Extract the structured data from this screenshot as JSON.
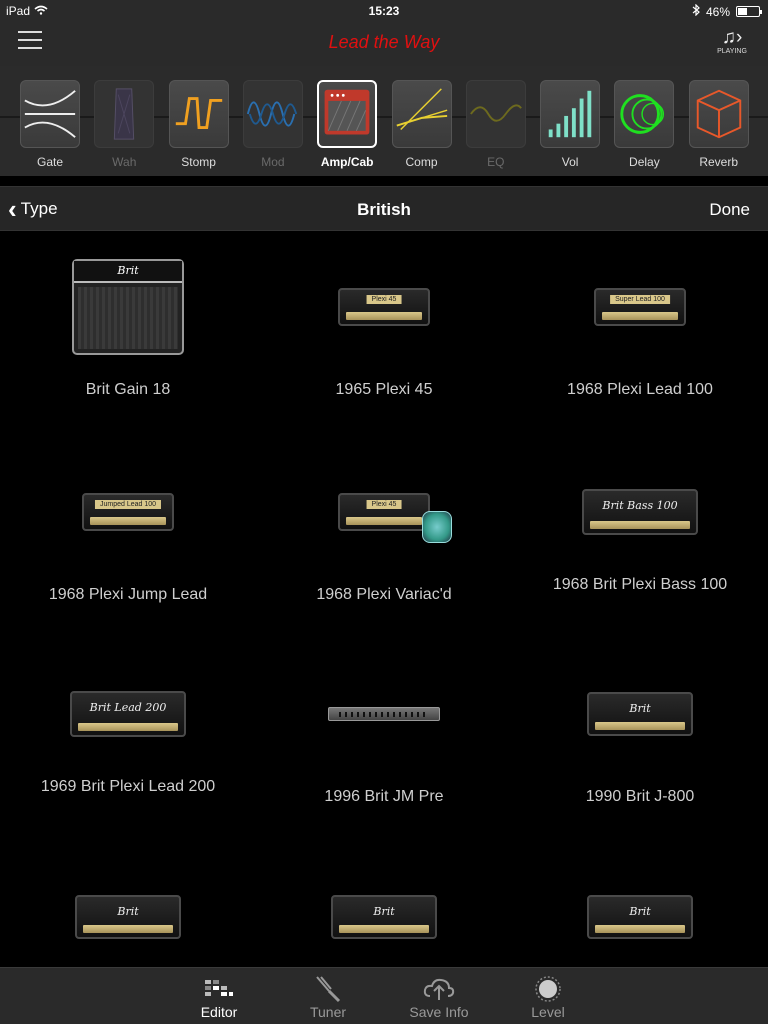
{
  "status_bar": {
    "device": "iPad",
    "time": "15:23",
    "battery": "46%",
    "battery_level": 0.46
  },
  "nav": {
    "preset_title": "Lead the Way",
    "playing_label": "PLAYING"
  },
  "effects_chain": [
    {
      "label": "Gate",
      "icon": "gate-icon",
      "state": "normal"
    },
    {
      "label": "Wah",
      "icon": "wah-icon",
      "state": "dim"
    },
    {
      "label": "Stomp",
      "icon": "stomp-icon",
      "state": "normal"
    },
    {
      "label": "Mod",
      "icon": "mod-icon",
      "state": "dim"
    },
    {
      "label": "Amp/Cab",
      "icon": "amp-icon",
      "state": "active"
    },
    {
      "label": "Comp",
      "icon": "comp-icon",
      "state": "normal"
    },
    {
      "label": "EQ",
      "icon": "eq-icon",
      "state": "dim"
    },
    {
      "label": "Vol",
      "icon": "vol-icon",
      "state": "normal"
    },
    {
      "label": "Delay",
      "icon": "delay-icon",
      "state": "normal"
    },
    {
      "label": "Reverb",
      "icon": "reverb-icon",
      "state": "normal"
    }
  ],
  "subheader": {
    "back_label": "Type",
    "title": "British",
    "done_label": "Done"
  },
  "amps": [
    {
      "label": "Brit Gain 18",
      "style": "combo",
      "logo": "Brit"
    },
    {
      "label": "1965 Plexi 45",
      "style": "plexi",
      "plate": "Plexi 45"
    },
    {
      "label": "1968 Plexi Lead 100",
      "style": "plexi",
      "plate": "Super Lead 100"
    },
    {
      "label": "1968 Plexi Jump Lead",
      "style": "plexi",
      "plate": "Jumped Lead 100"
    },
    {
      "label": "1968 Plexi Variac'd",
      "style": "variac",
      "plate": "Plexi 45"
    },
    {
      "label": "1968 Brit Plexi Bass 100",
      "style": "brit",
      "logo": "Brit Bass 100"
    },
    {
      "label": "1969 Brit Plexi Lead 200",
      "style": "brit",
      "logo": "Brit Lead 200"
    },
    {
      "label": "1996 Brit JM Pre",
      "style": "rack"
    },
    {
      "label": "1990 Brit J-800",
      "style": "brit",
      "logo": "Brit"
    },
    {
      "label": "",
      "style": "brit",
      "logo": "Brit"
    },
    {
      "label": "",
      "style": "brit",
      "logo": "Brit"
    },
    {
      "label": "",
      "style": "brit",
      "logo": "Brit"
    }
  ],
  "tab_bar": [
    {
      "label": "Editor",
      "icon": "editor-icon",
      "active": true
    },
    {
      "label": "Tuner",
      "icon": "tuner-icon",
      "active": false
    },
    {
      "label": "Save Info",
      "icon": "cloud-upload-icon",
      "active": false
    },
    {
      "label": "Level",
      "icon": "level-knob-icon",
      "active": false
    }
  ],
  "colors": {
    "accent_red": "#e01010",
    "background": "#000000",
    "bar": "#2a2a2a"
  }
}
